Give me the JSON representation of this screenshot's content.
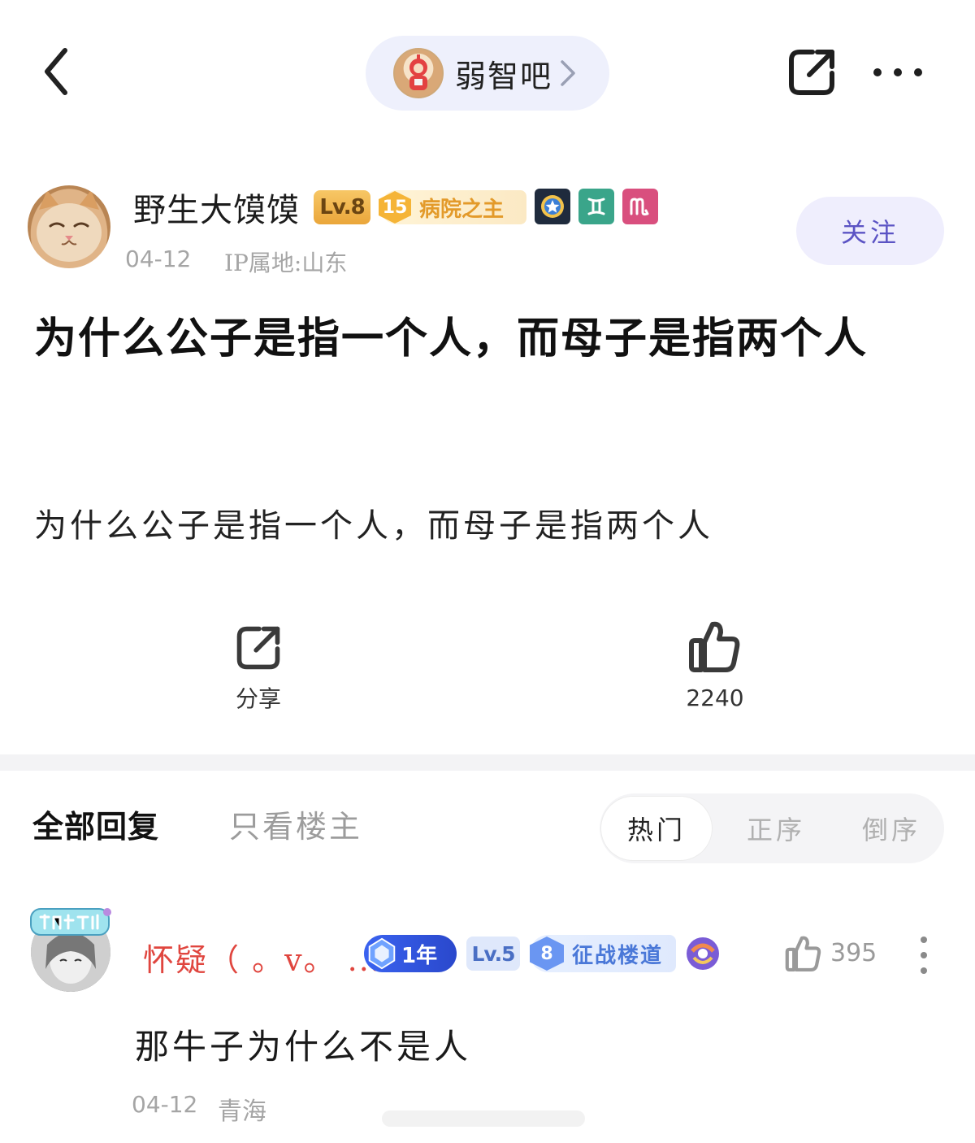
{
  "header": {
    "forum_name": "弱智吧",
    "icons": {
      "back": "chevron-left-icon",
      "share": "share-icon",
      "more": "more-icon",
      "forum_chevron": "chevron-right-icon"
    }
  },
  "post": {
    "author": {
      "name": "野生大馍馍",
      "level": "Lv.8",
      "title_badge": {
        "number": "15",
        "text": "病院之主"
      },
      "date": "04-12",
      "ip": "IP属地:山东"
    },
    "follow_label": "关注",
    "title": "为什么公子是指一个人，而母子是指两个人",
    "body": "为什么公子是指一个人，而母子是指两个人",
    "actions": {
      "share_label": "分享",
      "like_count": "2240"
    }
  },
  "replies": {
    "tab_all": "全部回复",
    "tab_owner": "只看楼主",
    "sort_options": [
      "热门",
      "正序",
      "倒序"
    ],
    "active_sort": "热门",
    "items": [
      {
        "name": "怀疑（ 。v。 ...",
        "year_badge": "1年",
        "level": "Lv.5",
        "rank_badge": {
          "number": "8",
          "text": "征战楼道"
        },
        "like_count": "395",
        "text": "那牛子为什么不是人",
        "date": "04-12",
        "location": "青海"
      }
    ]
  },
  "colors": {
    "accent_purple": "#5b53c4",
    "name_red": "#e0463f",
    "pill_bg": "#eef0fc",
    "muted_gray": "#a5a5a5"
  }
}
